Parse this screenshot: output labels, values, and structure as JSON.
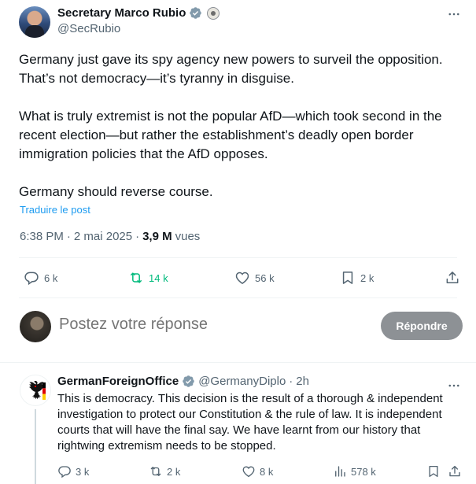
{
  "post": {
    "author_name": "Secretary Marco Rubio",
    "author_handle": "@SecRubio",
    "paragraphs": [
      "Germany just gave its spy agency new powers to surveil the opposition. That’s not democracy—it’s tyranny in disguise.",
      "What is truly extremist is not the popular AfD—which took second in the recent election—but rather the establishment’s deadly open border immigration policies that the AfD opposes.",
      "Germany should reverse course."
    ],
    "translate_label": "Traduire le post",
    "time": "6:38 PM",
    "date": "2 mai 2025",
    "views_count": "3,9 M",
    "views_label": "vues",
    "stats": {
      "replies": "6 k",
      "reposts": "14 k",
      "likes": "56 k",
      "bookmarks": "2 k"
    }
  },
  "composer": {
    "placeholder": "Postez votre réponse",
    "reply_button": "Répondre"
  },
  "reply": {
    "author_name": "GermanForeignOffice",
    "author_handle": "@GermanyDiplo",
    "separator": "·",
    "time": "2h",
    "text": "This is democracy. This decision is the result of a thorough & independent investigation to protect our Constitution & the rule of law. It is independent courts that will have the final say. We have learnt from our history that rightwing extremism needs to be stopped.",
    "stats": {
      "replies": "3 k",
      "reposts": "2 k",
      "likes": "8 k",
      "views": "578 k"
    }
  },
  "colors": {
    "accent": "#1d9bf0",
    "retweet_green": "#00ba7c",
    "muted_text": "#536471",
    "reply_button_bg": "#8d9195"
  }
}
